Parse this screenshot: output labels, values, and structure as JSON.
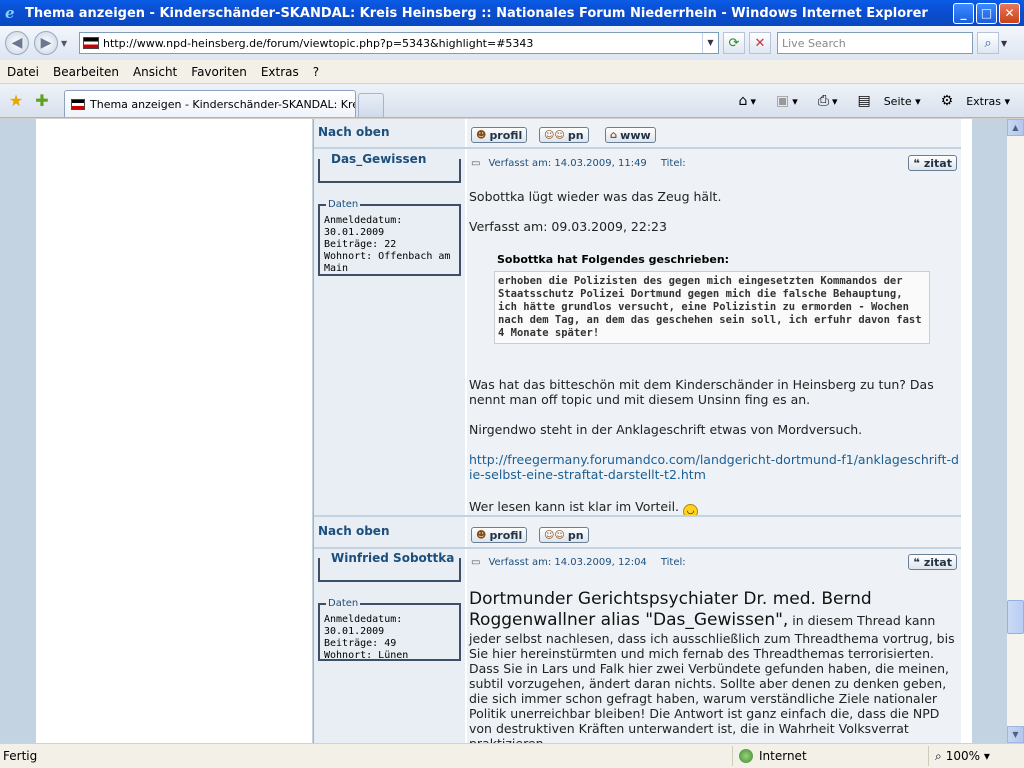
{
  "window": {
    "title": "Thema anzeigen - Kinderschänder-SKANDAL: Kreis Heinsberg :: Nationales Forum Niederrhein - Windows Internet Explorer",
    "minimize": "_",
    "maximize": "□",
    "close": "✕"
  },
  "address": {
    "url": "http://www.npd-heinsberg.de/forum/viewtopic.php?p=5343&highlight=#5343",
    "search_placeholder": "Live Search"
  },
  "menu": [
    "Datei",
    "Bearbeiten",
    "Ansicht",
    "Favoriten",
    "Extras",
    "?"
  ],
  "tab": {
    "label": "Thema anzeigen - Kinderschänder-SKANDAL: Kreis Hei..."
  },
  "commands": {
    "page": "Seite",
    "tools": "Extras"
  },
  "posts": {
    "nach_oben": "Nach oben",
    "profil": "profil",
    "pn": "pn",
    "www": "www",
    "zitat": "zitat",
    "titel_label": "Titel:",
    "daten_label": "Daten",
    "post1": {
      "author": "Das_Gewissen",
      "meta": [
        "Anmeldedatum:",
        "30.01.2009",
        "Beiträge: 22",
        "Wohnort: Offenbach am Main"
      ],
      "date": "Verfasst am: 14.03.2009, 11:49",
      "p1": "Sobottka lügt wieder was das Zeug hält.",
      "p2": "Verfasst am: 09.03.2009, 22:23",
      "quote_header": "Sobottka hat Folgendes geschrieben:",
      "quote": "erhoben die Polizisten des gegen mich eingesetzten Kommandos der Staatsschutz Polizei Dortmund gegen mich die falsche Behauptung, ich hätte grundlos versucht, eine Polizistin zu ermorden - Wochen nach dem Tag, an dem das geschehen sein soll, ich erfuhr davon fast 4 Monate später!",
      "p3": "Was hat das bitteschön mit dem Kinderschänder in Heinsberg zu tun? Das nennt man off topic und mit diesem Unsinn fing es an.",
      "p4": "Nirgendwo steht in der Anklageschrift etwas von Mordversuch.",
      "link": "http://freegermany.forumandco.com/landgericht-dortmund-f1/anklageschrift-die-selbst-eine-straftat-darstellt-t2.htm",
      "p5": "Wer lesen kann ist klar im Vorteil."
    },
    "post2": {
      "author": "Winfried Sobottka",
      "meta": [
        "Anmeldedatum:",
        "30.01.2009",
        "Beiträge: 49",
        "Wohnort: Lünen"
      ],
      "date": "Verfasst am: 14.03.2009, 12:04",
      "big": "Dortmunder Gerichtspsychiater Dr. med. Bernd Roggenwallner alias \"Das_Gewissen\",",
      "rest": " in diesem Thread kann jeder selbst nachlesen, dass ich ausschließlich zum Threadthema vortrug, bis Sie hier hereinstürmten und mich fernab des Threadthemas terrorisierten. Dass Sie in Lars und Falk hier zwei Verbündete gefunden haben, die meinen, subtil vorzugehen, ändert daran nichts. Sollte aber denen zu denken geben, die sich immer schon gefragt haben, warum verständliche Ziele nationaler Politik unerreichbar bleiben! Die Antwort ist ganz einfach die, dass die NPD von destruktiven Kräften unterwandert ist, die in Wahrheit Volksverrat praktizieren."
    }
  },
  "status": {
    "text": "Fertig",
    "zone": "Internet",
    "zoom": "100%"
  }
}
